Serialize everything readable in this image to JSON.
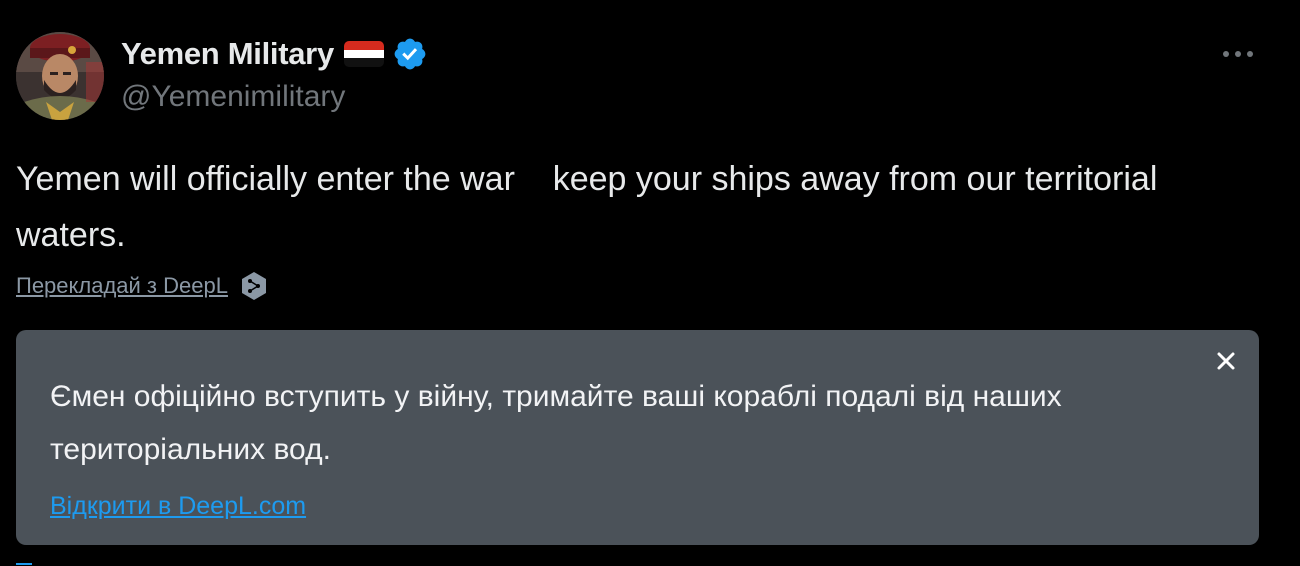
{
  "tweet": {
    "author": {
      "display_name": "Yemen Military",
      "handle": "@Yemenimilitary",
      "flag_icon": "yemen-flag-icon",
      "verified_icon": "verified-badge-icon",
      "verified_color": "#1d9bf0"
    },
    "more_icon": "more-dots-icon",
    "text": "Yemen will officially enter the war    keep your ships away from our territorial waters.",
    "translate_link": "Перекладай з DeepL",
    "translate_icon": "deepl-icon"
  },
  "translation": {
    "text": "Ємен офіційно вступить у війну, тримайте ваші кораблі подалі від наших територіальних вод.",
    "open_link": "Відкрити в DeepL.com",
    "close_icon": "close-icon"
  },
  "colors": {
    "background": "#000000",
    "text_primary": "#e7e9ea",
    "text_secondary": "#71767b",
    "accent": "#1d9bf0",
    "translation_box": "#4b5259"
  }
}
